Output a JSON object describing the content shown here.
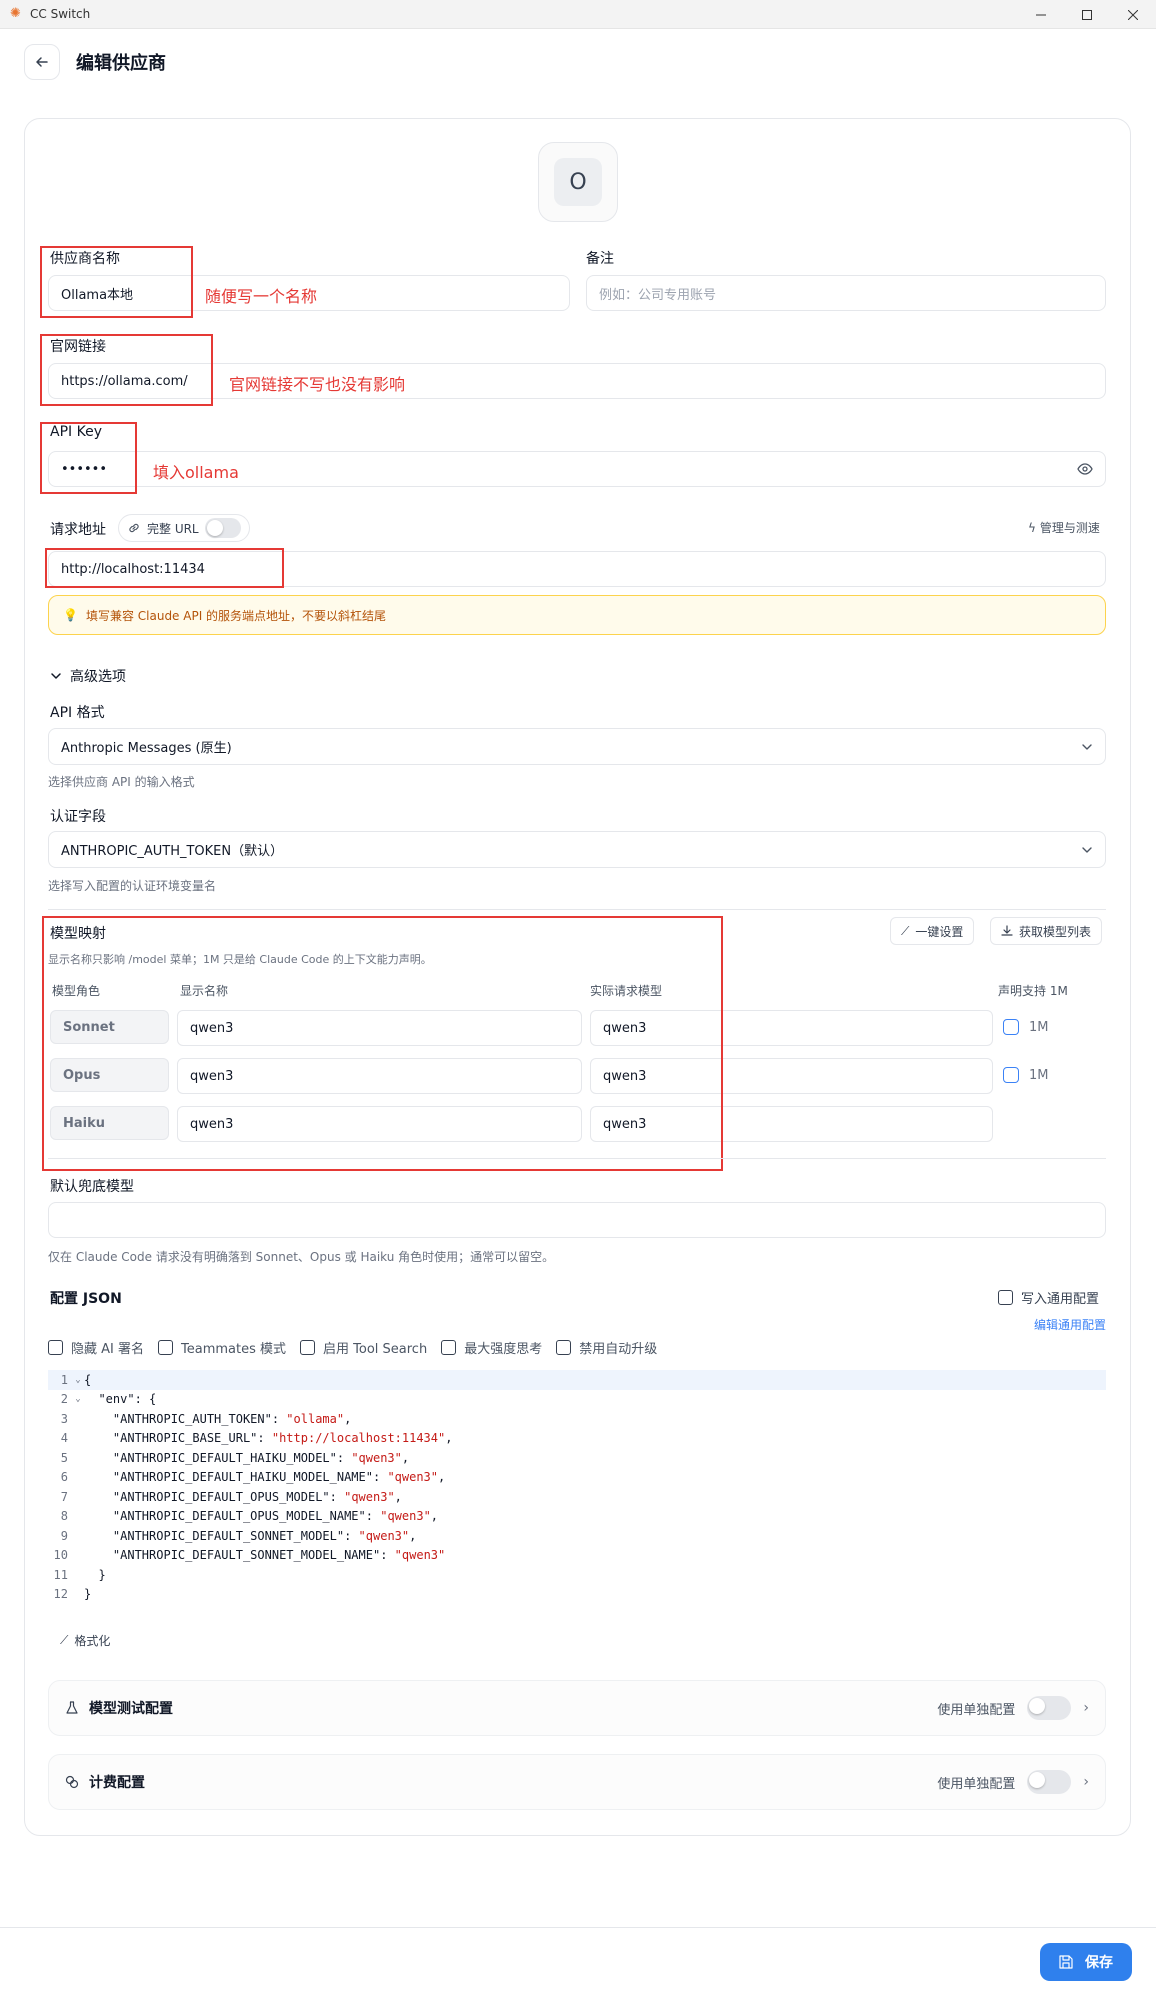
{
  "window": {
    "title": "CC Switch"
  },
  "header": {
    "title": "编辑供应商"
  },
  "avatar": {
    "letter": "O"
  },
  "fields": {
    "name_label": "供应商名称",
    "name_value": "Ollama本地",
    "note_label": "备注",
    "note_placeholder": "例如：公司专用账号",
    "website_label": "官网链接",
    "website_value": "https://ollama.com/",
    "apikey_label": "API Key",
    "apikey_value": "••••••",
    "endpoint_label": "请求地址",
    "full_url_label": "完整 URL",
    "manage_label": "管理与测速",
    "endpoint_value": "http://localhost:11434",
    "endpoint_hint": "填写兼容 Claude API 的服务端点地址，不要以斜杠结尾"
  },
  "annotations": {
    "name": "随便写一个名称",
    "website": "官网链接不写也没有影响",
    "apikey": "填入ollama"
  },
  "advanced": {
    "toggle_label": "高级选项",
    "api_format_label": "API 格式",
    "api_format_value": "Anthropic Messages (原生)",
    "api_format_hint": "选择供应商 API 的输入格式",
    "auth_field_label": "认证字段",
    "auth_field_value": "ANTHROPIC_AUTH_TOKEN（默认）",
    "auth_field_hint": "选择写入配置的认证环境变量名"
  },
  "model_mapping": {
    "title": "模型映射",
    "description": "显示名称只影响 /model 菜单；1M 只是给 Claude Code 的上下文能力声明。",
    "quick_setup": "一键设置",
    "fetch_models": "获取模型列表",
    "col_role": "模型角色",
    "col_display": "显示名称",
    "col_actual": "实际请求模型",
    "col_1m": "声明支持 1M",
    "rows": [
      {
        "role": "Sonnet",
        "display": "qwen3",
        "actual": "qwen3",
        "one_m": "1M"
      },
      {
        "role": "Opus",
        "display": "qwen3",
        "actual": "qwen3",
        "one_m": "1M"
      },
      {
        "role": "Haiku",
        "display": "qwen3",
        "actual": "qwen3",
        "one_m": ""
      }
    ],
    "fallback_label": "默认兜底模型",
    "fallback_hint": "仅在 Claude Code 请求没有明确落到 Sonnet、Opus 或 Haiku 角色时使用；通常可以留空。"
  },
  "config_json": {
    "title": "配置 JSON",
    "write_common": "写入通用配置",
    "edit_common": "编辑通用配置",
    "options": [
      "隐藏 AI 署名",
      "Teammates 模式",
      "启用 Tool Search",
      "最大强度思考",
      "禁用自动升级"
    ],
    "format_label": "格式化"
  },
  "panels": {
    "model_test": "模型测试配置",
    "billing": "计费配置",
    "use_separate": "使用单独配置"
  },
  "footer": {
    "save_label": "保存"
  },
  "colors": {
    "accent": "#2f80ed",
    "annotation": "#e53935",
    "warning_bg": "#fffbeb",
    "warning_text": "#b45309"
  }
}
